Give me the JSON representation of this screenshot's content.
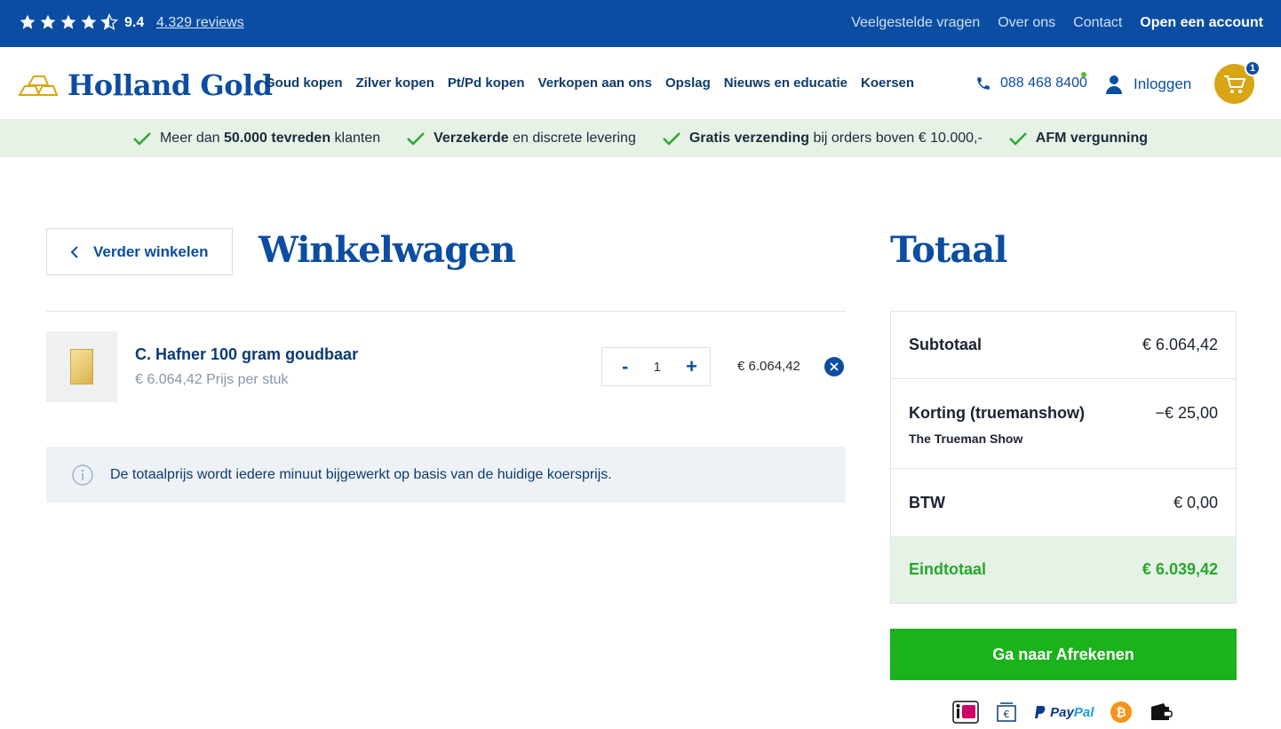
{
  "topbar": {
    "rating": "9.4",
    "reviews": "4.329 reviews",
    "links": [
      "Veelgestelde vragen",
      "Over ons",
      "Contact"
    ],
    "account": "Open een account"
  },
  "header": {
    "logo": "Holland Gold",
    "nav": [
      "Goud kopen",
      "Zilver kopen",
      "Pt/Pd kopen",
      "Verkopen aan ons",
      "Opslag",
      "Nieuws en educatie",
      "Koersen"
    ],
    "phone": "088 468 8400",
    "login": "Inloggen",
    "cart_count": "1"
  },
  "usp": [
    {
      "pre": "Meer dan ",
      "bold": "50.000 tevreden",
      "post": " klanten"
    },
    {
      "pre": "",
      "bold": "Verzekerde",
      "post": " en discrete levering"
    },
    {
      "pre": "",
      "bold": "Gratis verzending",
      "post": " bij orders boven € 10.000,-"
    },
    {
      "pre": "",
      "bold": "AFM vergunning",
      "post": ""
    }
  ],
  "cart": {
    "back": "Verder winkelen",
    "title": "Winkelwagen",
    "item": {
      "name": "C. Hafner 100 gram goudbaar",
      "unit_price": "€ 6.064,42 Prijs per stuk",
      "minus": "-",
      "qty": "1",
      "plus": "+",
      "total": "€ 6.064,42"
    },
    "info": "De totaalprijs wordt iedere minuut bijgewerkt op basis van de huidige koersprijs."
  },
  "totals": {
    "title": "Totaal",
    "subtotal_label": "Subtotaal",
    "subtotal_value": "€ 6.064,42",
    "discount_label": "Korting (truemanshow)",
    "discount_sub": "The Trueman Show",
    "discount_value": "−€ 25,00",
    "btw_label": "BTW",
    "btw_value": "€ 0,00",
    "total_label": "Eindtotaal",
    "total_value": "€ 6.039,42",
    "checkout": "Ga naar Afrekenen"
  },
  "payments": {
    "paypal_pay": "Pay",
    "paypal_pal": "Pal"
  }
}
